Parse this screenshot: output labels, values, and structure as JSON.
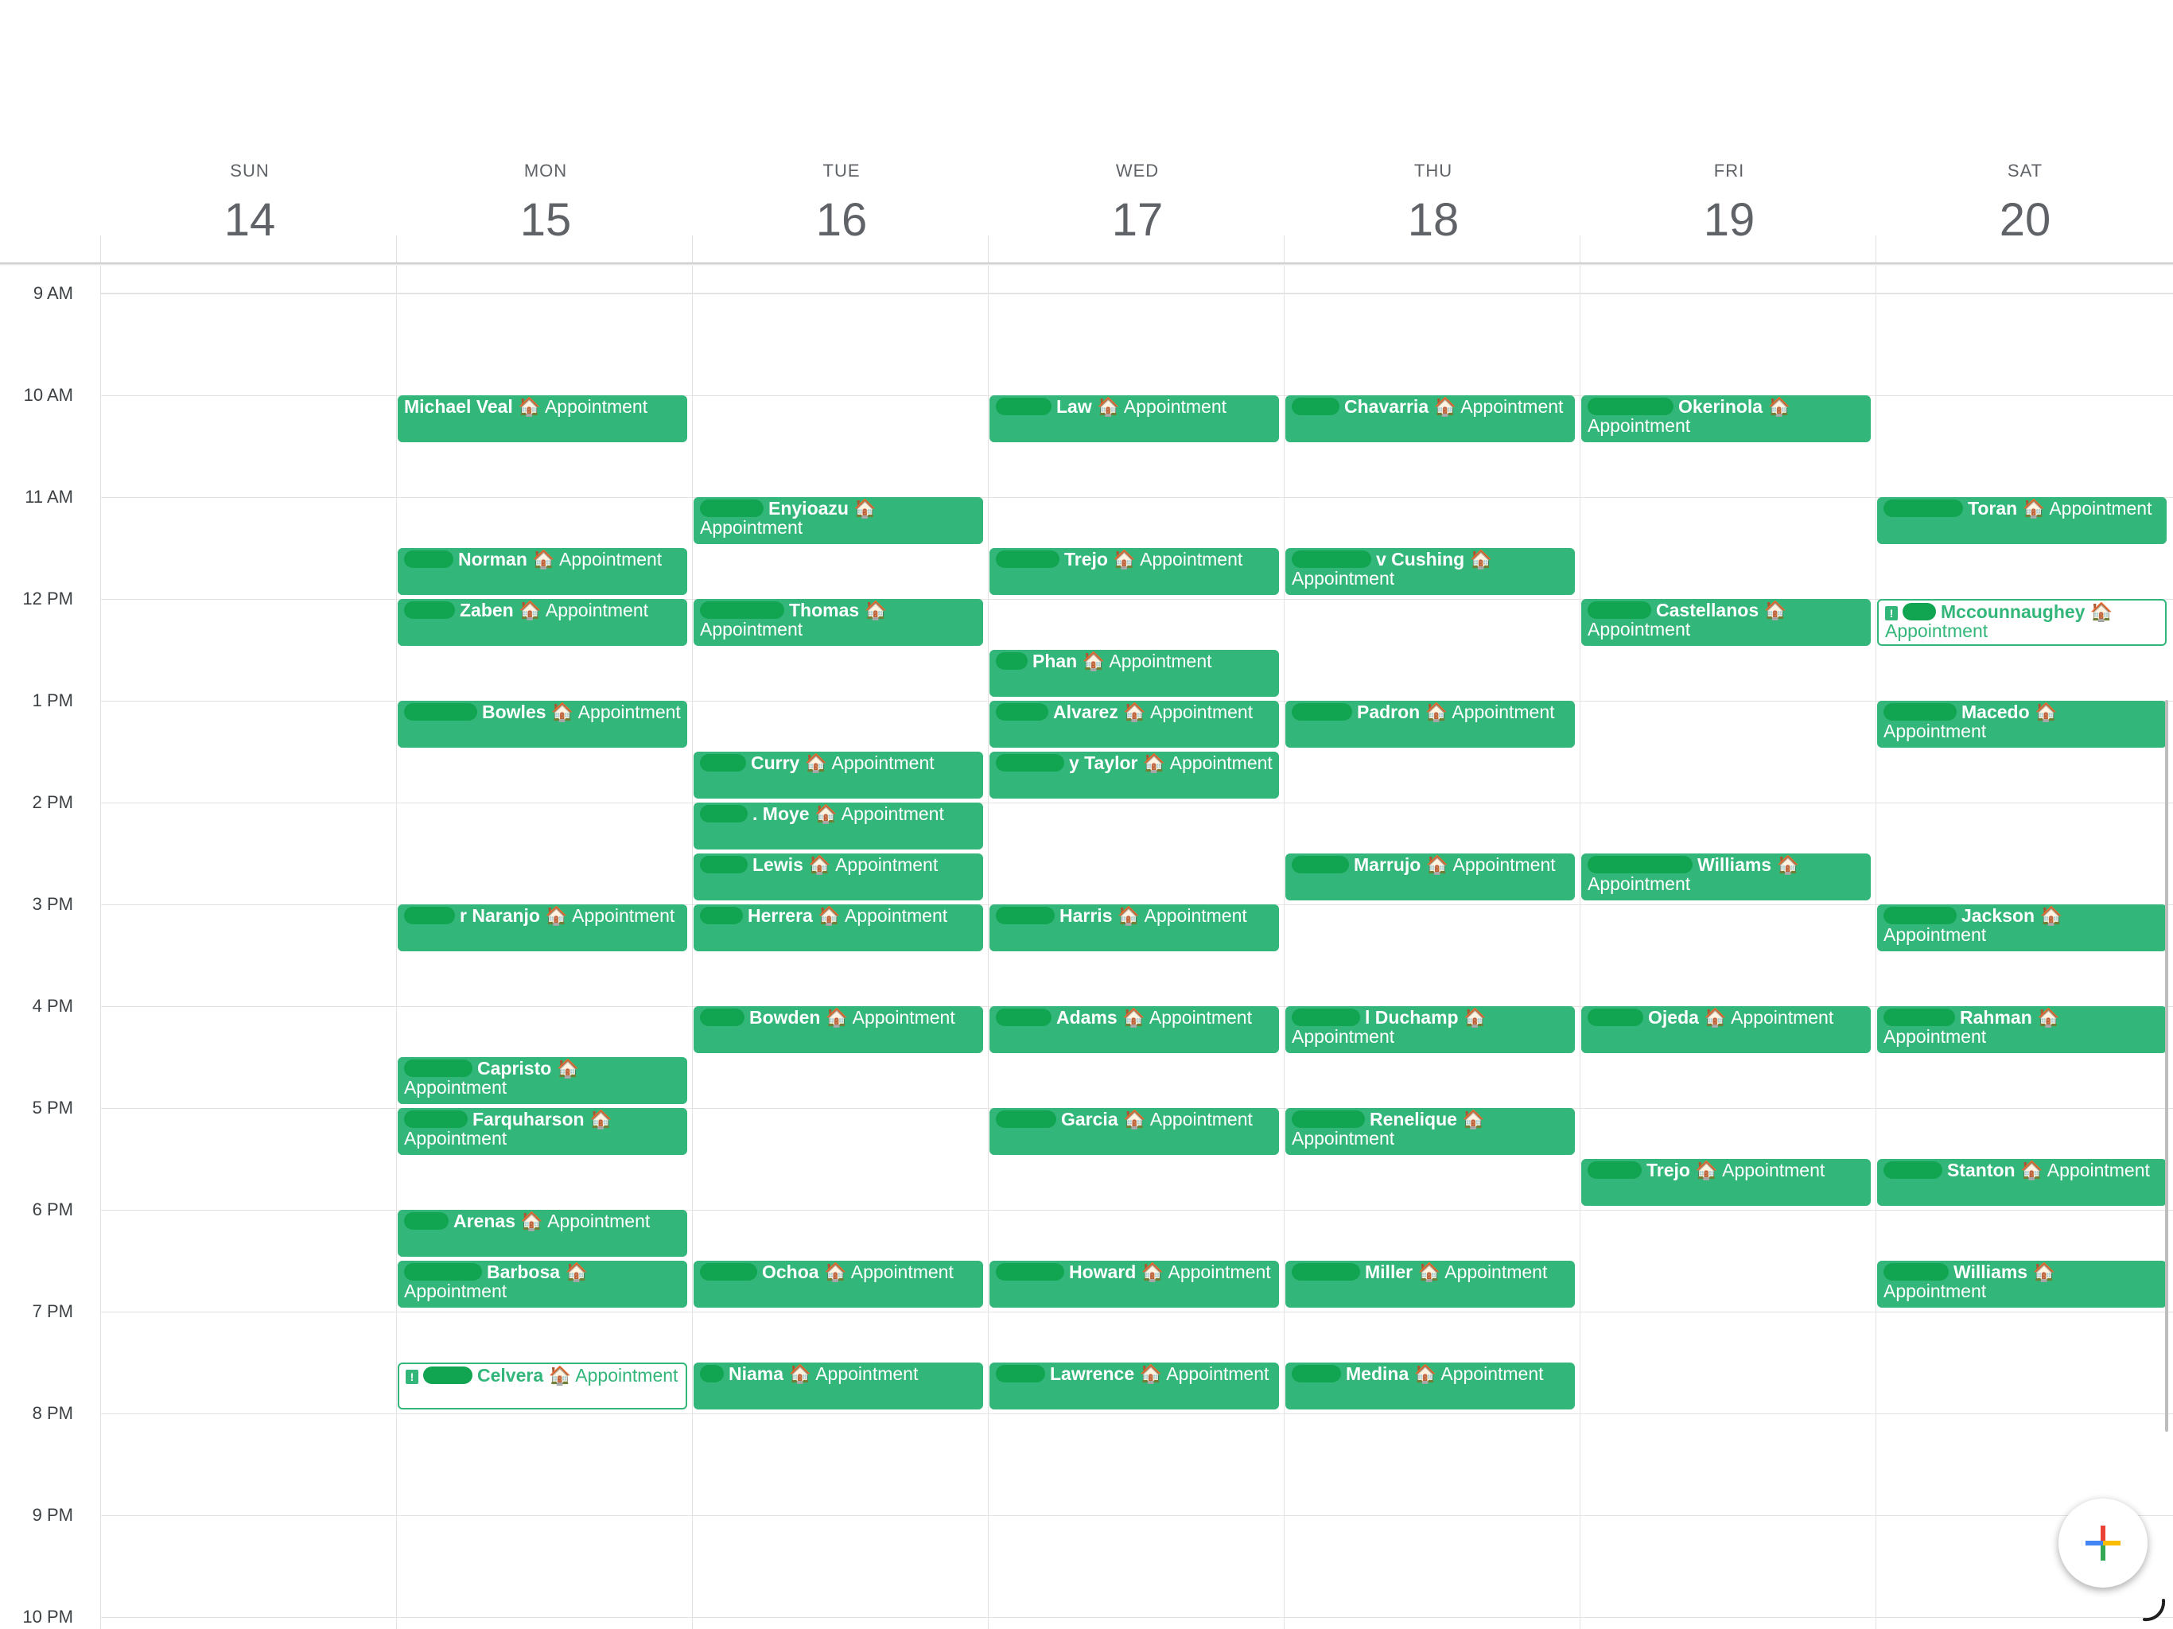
{
  "week": {
    "days": [
      {
        "dow": "SUN",
        "date": "14"
      },
      {
        "dow": "MON",
        "date": "15"
      },
      {
        "dow": "TUE",
        "date": "16"
      },
      {
        "dow": "WED",
        "date": "17"
      },
      {
        "dow": "THU",
        "date": "18"
      },
      {
        "dow": "FRI",
        "date": "19"
      },
      {
        "dow": "SAT",
        "date": "20"
      }
    ]
  },
  "hours": [
    "9 AM",
    "10 AM",
    "11 AM",
    "12 PM",
    "1 PM",
    "2 PM",
    "3 PM",
    "4 PM",
    "5 PM",
    "6 PM",
    "7 PM",
    "8 PM",
    "9 PM",
    "10 PM"
  ],
  "calendar_color": "#33b679",
  "events": {
    "mon": [
      {
        "name": "Michael Veal",
        "suffix": "🏠 Appointment"
      },
      {
        "name": "Norman",
        "suffix": "🏠 Appointment"
      },
      {
        "name": "Zaben",
        "suffix": "🏠 Appointment"
      },
      {
        "name": "Bowles",
        "suffix": "🏠 Appointment"
      },
      {
        "name": "r Naranjo",
        "suffix": "🏠 Appointment"
      },
      {
        "name": "Capristo",
        "suffix": "🏠 Appointment"
      },
      {
        "name": "Farquharson",
        "suffix": "🏠 Appointment"
      },
      {
        "name": "Arenas",
        "suffix": "🏠 Appointment"
      },
      {
        "name": "Barbosa",
        "suffix": "🏠 Appointment"
      },
      {
        "name": "Celvera",
        "suffix": "🏠 Appointment"
      }
    ],
    "tue": [
      {
        "name": "Enyioazu",
        "suffix": "🏠 Appointment"
      },
      {
        "name": "Thomas",
        "suffix": "🏠 Appointment"
      },
      {
        "name": "Curry",
        "suffix": "🏠 Appointment"
      },
      {
        "name": ". Moye",
        "suffix": "🏠 Appointment"
      },
      {
        "name": "Lewis",
        "suffix": "🏠 Appointment"
      },
      {
        "name": "Herrera",
        "suffix": "🏠 Appointment"
      },
      {
        "name": "Bowden",
        "suffix": "🏠 Appointment"
      },
      {
        "name": "Ochoa",
        "suffix": "🏠 Appointment"
      },
      {
        "name": "Niama",
        "suffix": "🏠 Appointment"
      }
    ],
    "wed": [
      {
        "name": "Law",
        "suffix": "🏠 Appointment"
      },
      {
        "name": "Trejo",
        "suffix": "🏠 Appointment"
      },
      {
        "name": "Phan",
        "suffix": "🏠 Appointment"
      },
      {
        "name": "Alvarez",
        "suffix": "🏠 Appointment"
      },
      {
        "name": "y Taylor",
        "suffix": "🏠 Appointment"
      },
      {
        "name": "Harris",
        "suffix": "🏠 Appointment"
      },
      {
        "name": "Adams",
        "suffix": "🏠 Appointment"
      },
      {
        "name": "Garcia",
        "suffix": "🏠 Appointment"
      },
      {
        "name": "Howard",
        "suffix": "🏠 Appointment"
      },
      {
        "name": "Lawrence",
        "suffix": "🏠 Appointment"
      }
    ],
    "thu": [
      {
        "name": "Chavarria",
        "suffix": "🏠 Appointment"
      },
      {
        "name": "v Cushing",
        "suffix": "🏠 Appointment"
      },
      {
        "name": "Padron",
        "suffix": "🏠 Appointment"
      },
      {
        "name": "Marrujo",
        "suffix": "🏠 Appointment"
      },
      {
        "name": "l Duchamp",
        "suffix": "🏠 Appointment"
      },
      {
        "name": "Renelique",
        "suffix": "🏠 Appointment"
      },
      {
        "name": "Miller",
        "suffix": "🏠 Appointment"
      },
      {
        "name": "Medina",
        "suffix": "🏠 Appointment"
      }
    ],
    "fri": [
      {
        "name": "Okerinola",
        "suffix": "🏠 Appointment"
      },
      {
        "name": "Castellanos",
        "suffix": "🏠 Appointment"
      },
      {
        "name": "Williams",
        "suffix": "🏠 Appointment"
      },
      {
        "name": "Ojeda",
        "suffix": "🏠 Appointment"
      },
      {
        "name": "Trejo",
        "suffix": "🏠 Appointment"
      }
    ],
    "sat": [
      {
        "name": "Toran",
        "suffix": "🏠 Appointment"
      },
      {
        "name": "Mccounnaughey",
        "suffix": "🏠 Appointment"
      },
      {
        "name": "Macedo",
        "suffix": "🏠 Appointment"
      },
      {
        "name": "Jackson",
        "suffix": "🏠 Appointment"
      },
      {
        "name": "Rahman",
        "suffix": "🏠 Appointment"
      },
      {
        "name": "Stanton",
        "suffix": "🏠 Appointment"
      },
      {
        "name": "Williams",
        "suffix": "🏠 Appointment"
      }
    ]
  },
  "fab": {
    "icon": "plus-icon"
  }
}
